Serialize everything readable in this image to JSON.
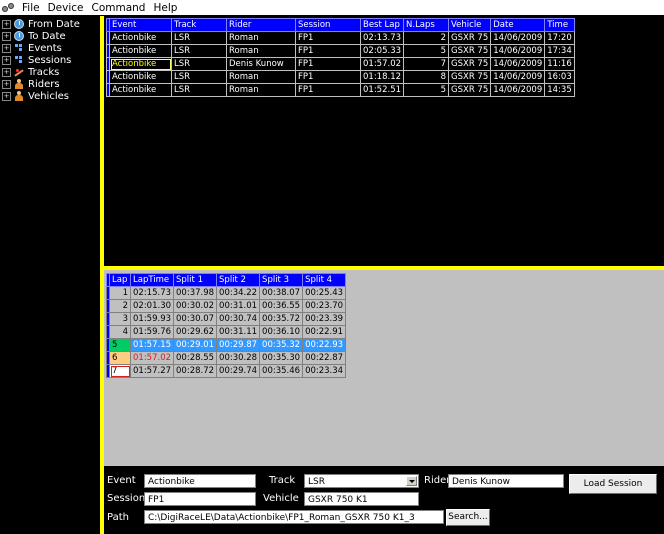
{
  "menu": [
    "File",
    "Device",
    "Command",
    "Help"
  ],
  "tree": [
    {
      "label": "From Date",
      "icon": "clock-icon"
    },
    {
      "label": "To Date",
      "icon": "clock-icon"
    },
    {
      "label": "Events",
      "icon": "tree-icon"
    },
    {
      "label": "Sessions",
      "icon": "tree-icon"
    },
    {
      "label": "Tracks",
      "icon": "track-icon"
    },
    {
      "label": "Riders",
      "icon": "rider-icon"
    },
    {
      "label": "Vehicles",
      "icon": "vehicle-icon"
    }
  ],
  "sessions": {
    "headers": [
      "Event",
      "Track",
      "Rider",
      "Session",
      "Best Lap",
      "N.Laps",
      "Vehicle",
      "Date",
      "Time"
    ],
    "rows": [
      [
        "Actionbike",
        "LSR",
        "Roman",
        "FP1",
        "02:13.73",
        "2",
        "GSXR 75",
        "14/06/2009",
        "17:20"
      ],
      [
        "Actionbike",
        "LSR",
        "Roman",
        "FP1",
        "02:05.33",
        "5",
        "GSXR 75",
        "14/06/2009",
        "17:34"
      ],
      [
        "Actionbike",
        "LSR",
        "Denis Kunow",
        "FP1",
        "01:57.02",
        "7",
        "GSXR 75",
        "14/06/2009",
        "11:16"
      ],
      [
        "Actionbike",
        "LSR",
        "Roman",
        "FP1",
        "01:18.12",
        "8",
        "GSXR 75",
        "14/06/2009",
        "16:03"
      ],
      [
        "Actionbike",
        "LSR",
        "Roman",
        "FP1",
        "01:52.51",
        "5",
        "GSXR 75",
        "14/06/2009",
        "14:35"
      ]
    ]
  },
  "laps": {
    "headers": [
      "Lap",
      "LapTime",
      "Split 1",
      "Split 2",
      "Split 3",
      "Split 4"
    ],
    "rows": [
      [
        "1",
        "02:15.73",
        "00:37.98",
        "00:34.22",
        "00:38.07",
        "00:25.43"
      ],
      [
        "2",
        "02:01.30",
        "00:30.02",
        "00:31.01",
        "00:36.55",
        "00:23.70"
      ],
      [
        "3",
        "01:59.93",
        "00:30.07",
        "00:30.74",
        "00:35.72",
        "00:23.39"
      ],
      [
        "4",
        "01:59.76",
        "00:29.62",
        "00:31.11",
        "00:36.10",
        "00:22.91"
      ],
      [
        "5",
        "01:57.15",
        "00:29.01",
        "00:29.87",
        "00:35.32",
        "00:22.93"
      ],
      [
        "6",
        "01:57.02",
        "00:28.55",
        "00:30.28",
        "00:35.30",
        "00:22.87"
      ],
      [
        "7",
        "01:57.27",
        "00:28.72",
        "00:29.74",
        "00:35.46",
        "00:23.34"
      ]
    ]
  },
  "form": {
    "event_label": "Event",
    "event_value": "Actionbike",
    "track_label": "Track",
    "track_value": "LSR",
    "rider_label": "Rider",
    "rider_value": "Denis Kunow",
    "session_label": "Session",
    "session_value": "FP1",
    "vehicle_label": "Vehicle",
    "vehicle_value": "GSXR 750 K1",
    "path_label": "Path",
    "path_value": "C:\\DigiRaceLE\\Data\\Actionbike\\FP1_Roman_GSXR 750 K1_3",
    "search_button": "Search...",
    "load_button": "Load Session"
  },
  "colors": {
    "header_blue": "#0000ff",
    "divider_yellow": "#ffff00",
    "selected_row": "#3399ff",
    "best_lap_red": "#d62020"
  }
}
